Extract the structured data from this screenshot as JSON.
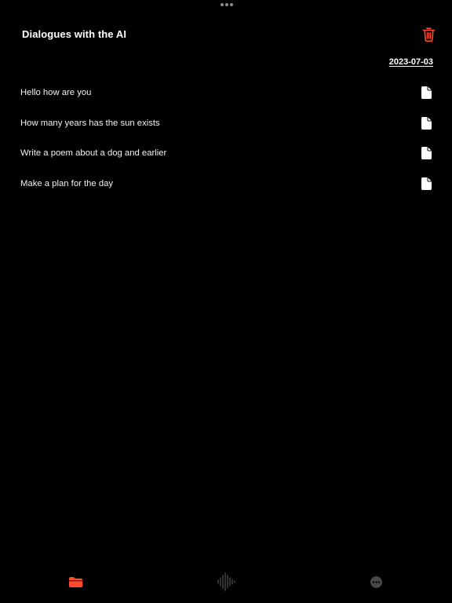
{
  "window": {
    "grabber_icon": "ellipsis-icon"
  },
  "header": {
    "title": "Dialogues with the AI",
    "trash_icon": "trash-icon"
  },
  "date": {
    "label": "2023-07-03"
  },
  "dialogues": [
    {
      "title": "Hello how are you",
      "icon": "document-icon"
    },
    {
      "title": "How many years has the sun exists",
      "icon": "document-icon"
    },
    {
      "title": "Write a poem about a dog and earlier",
      "icon": "document-icon"
    },
    {
      "title": "Make a plan for the day",
      "icon": "document-icon"
    }
  ],
  "tabbar": {
    "tabs": [
      {
        "icon": "folder-icon",
        "active": true
      },
      {
        "icon": "waveform-icon",
        "active": false
      },
      {
        "icon": "more-circle-icon",
        "active": false
      }
    ]
  },
  "colors": {
    "background": "#000000",
    "accent": "#ff4a2e",
    "text": "#ffffff",
    "inactive_icon": "#48484a"
  }
}
